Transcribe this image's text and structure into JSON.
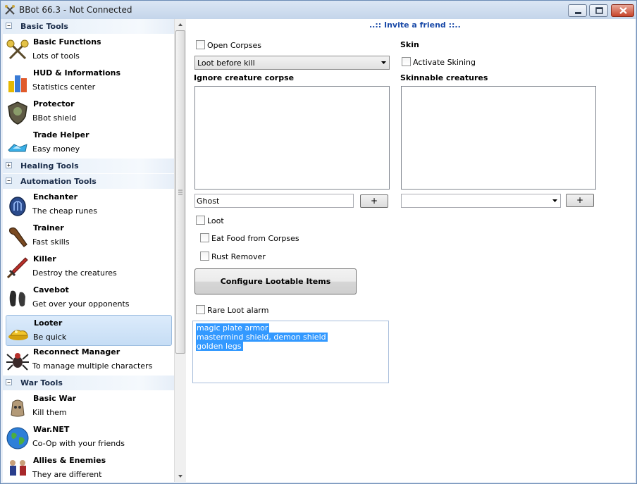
{
  "window": {
    "title": "BBot 66.3 - Not Connected",
    "controls": [
      "minimize-icon",
      "maximize-icon",
      "close-icon"
    ]
  },
  "sidebar": {
    "groups": [
      {
        "label": "Basic Tools",
        "expanded": true,
        "items": [
          {
            "title": "Basic Functions",
            "subtitle": "Lots of tools",
            "icon": "crossed-wands-icon"
          },
          {
            "title": "HUD & Informations",
            "subtitle": "Statistics center",
            "icon": "bar-chart-icon"
          },
          {
            "title": "Protector",
            "subtitle": "BBot shield",
            "icon": "shield-icon"
          },
          {
            "title": "Trade Helper",
            "subtitle": "Easy money",
            "icon": "crystal-coins-icon"
          }
        ]
      },
      {
        "label": "Healing Tools",
        "expanded": false,
        "items": []
      },
      {
        "label": "Automation Tools",
        "expanded": true,
        "items": [
          {
            "title": "Enchanter",
            "subtitle": "The cheap runes",
            "icon": "rune-icon"
          },
          {
            "title": "Trainer",
            "subtitle": "Fast skills",
            "icon": "club-icon"
          },
          {
            "title": "Killer",
            "subtitle": "Destroy the creatures",
            "icon": "sword-icon"
          },
          {
            "title": "Cavebot",
            "subtitle": "Get over your opponents",
            "icon": "footprints-icon"
          },
          {
            "title": "Looter",
            "subtitle": "Be quick",
            "icon": "gold-pile-icon",
            "selected": true
          },
          {
            "title": "Reconnect Manager",
            "subtitle": "To manage multiple characters",
            "icon": "spider-icon"
          }
        ]
      },
      {
        "label": "War Tools",
        "expanded": true,
        "items": [
          {
            "title": "Basic War",
            "subtitle": "Kill them",
            "icon": "skull-bag-icon"
          },
          {
            "title": "War.NET",
            "subtitle": "Co-Op with your friends",
            "icon": "globe-icon"
          },
          {
            "title": "Allies & Enemies",
            "subtitle": "They are different",
            "icon": "warriors-icon"
          }
        ]
      }
    ]
  },
  "main": {
    "invite_link": "..:: Invite a friend ::..",
    "open_corpses": {
      "label": "Open Corpses",
      "checked": false
    },
    "loot_mode": {
      "value": "Loot before kill"
    },
    "ignore_creature": {
      "label": "Ignore creature corpse",
      "input_value": "Ghost",
      "add_label": "+"
    },
    "skin": {
      "heading": "Skin",
      "activate_label": "Activate Skining",
      "checked": false
    },
    "skinnable": {
      "label": "Skinnable creatures",
      "combo_value": "",
      "add_label": "+"
    },
    "loot": {
      "label": "Loot",
      "checked": false
    },
    "eat_food": {
      "label": "Eat Food from Corpses",
      "checked": false
    },
    "rust_remover": {
      "label": "Rust Remover",
      "checked": false
    },
    "configure_button": "Configure Lootable Items",
    "rare_loot": {
      "label": "Rare Loot alarm",
      "checked": false,
      "lines": [
        "magic plate armor",
        "mastermind shield, demon shield",
        "golden legs"
      ]
    }
  },
  "colors": {
    "accent": "#1a4aa8",
    "selection": "#3399ff",
    "selected_item": "#c6ddf5",
    "group_header": "#e3edf8"
  }
}
